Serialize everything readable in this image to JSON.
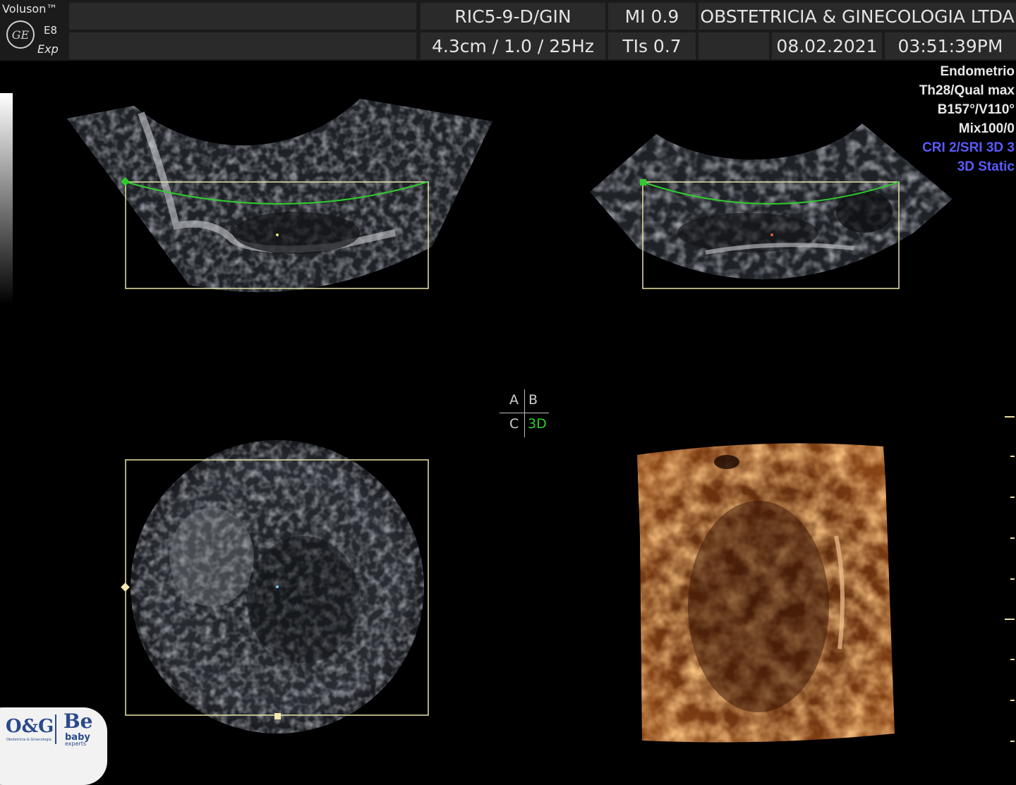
{
  "header": {
    "brand": "Voluson™",
    "model": "E8",
    "edition": "Exp",
    "ge_logo": "GE",
    "probe": "RIC5-9-D/GIN",
    "mi": "MI  0.9",
    "institution": "OBSTETRICIA & GINECOLOGIA LTDA",
    "depth_freq": "4.3cm / 1.0 / 25Hz",
    "tis": "TIs  0.7",
    "date": "08.02.2021",
    "time": "03:51:39PM"
  },
  "info": {
    "preset": "Endometrio",
    "quality": "Th28/Qual max",
    "angles": "B157°/V110°",
    "mix": "Mix100/0",
    "cri": "CRI 2/SRI 3D 3",
    "mode": "3D Static"
  },
  "quad": {
    "a": "A",
    "b": "B",
    "c": "C",
    "d": "3D"
  },
  "logo": {
    "og": "O&G",
    "og_sub": "Obstetrícia & Ginecologia",
    "be": "Be",
    "baby": "baby",
    "experts": "experts"
  },
  "colors": {
    "header_bg": "#1b1b1b",
    "cell_bg": "#2a2a2a",
    "roi_box": "#e8e6a8",
    "curve": "#2fcc2f",
    "info_blue": "#5a5aff",
    "render_orange": "#b0551a"
  }
}
